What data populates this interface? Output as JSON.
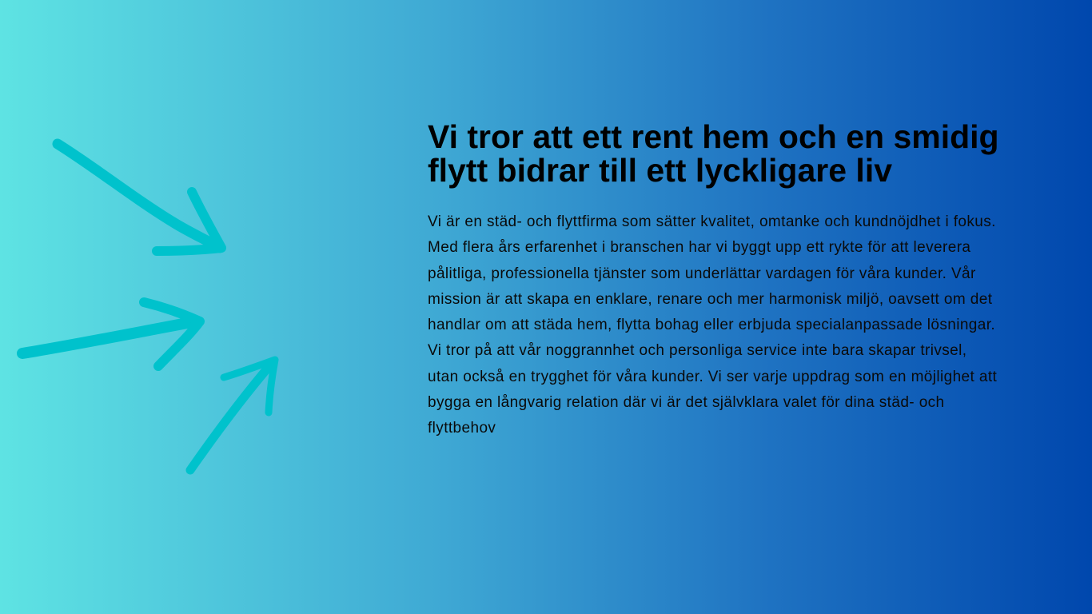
{
  "hero": {
    "headline": "Vi tror att ett rent hem och en smidig flytt bidrar till ett lyckligare liv",
    "body": "Vi är en städ- och flyttfirma som sätter kvalitet, omtanke och kundnöjdhet i fokus. Med flera års erfarenhet i branschen har vi byggt upp ett rykte för att leverera pålitliga, professionella tjänster som underlättar vardagen för våra kunder. Vår mission är att skapa en enklare, renare och mer harmonisk miljö, oavsett om det handlar om att städa hem, flytta bohag eller erbjuda specialanpassade lösningar. Vi tror på att vår noggrannhet och personliga service inte bara skapar trivsel, utan också en trygghet för våra kunder. Vi ser varje uppdrag som en möjlighet att bygga en långvarig relation där vi är det självklara valet för dina städ- och flyttbehov"
  },
  "decoration": {
    "icons": [
      "arrow-icon-down-right",
      "arrow-icon-right",
      "arrow-icon-up-right"
    ],
    "arrow_color": "#00c2cc"
  },
  "colors": {
    "gradient_start": "#5ee3e3",
    "gradient_end": "#0047ad",
    "text": "#000000"
  }
}
